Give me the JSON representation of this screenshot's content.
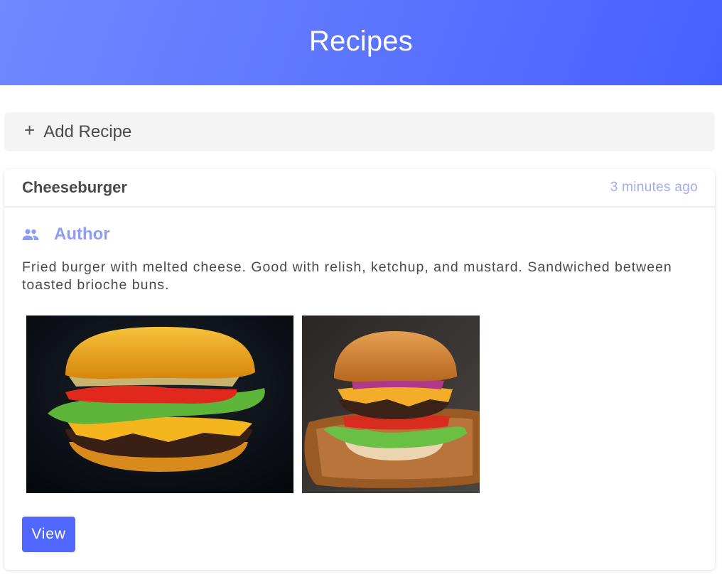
{
  "header": {
    "title": "Recipes"
  },
  "add_recipe": {
    "icon": "plus-icon",
    "label": "Add Recipe"
  },
  "recipe_card": {
    "title": "Cheeseburger",
    "timestamp": "3 minutes ago",
    "author": {
      "icon": "people-icon",
      "label": "Author"
    },
    "description": "Fried burger with melted cheese. Good with relish, ketchup, and mustard. Sandwiched between toasted brioche buns.",
    "images": [
      {
        "name": "cheeseburger-photo-dark"
      },
      {
        "name": "cheeseburger-photo-board"
      }
    ],
    "view_label": "View"
  },
  "colors": {
    "header_start": "#7089ff",
    "header_end": "#4660ff",
    "accent": "#5068ff",
    "author_text": "#8f9cf6",
    "timestamp_text": "#a3acf0"
  }
}
